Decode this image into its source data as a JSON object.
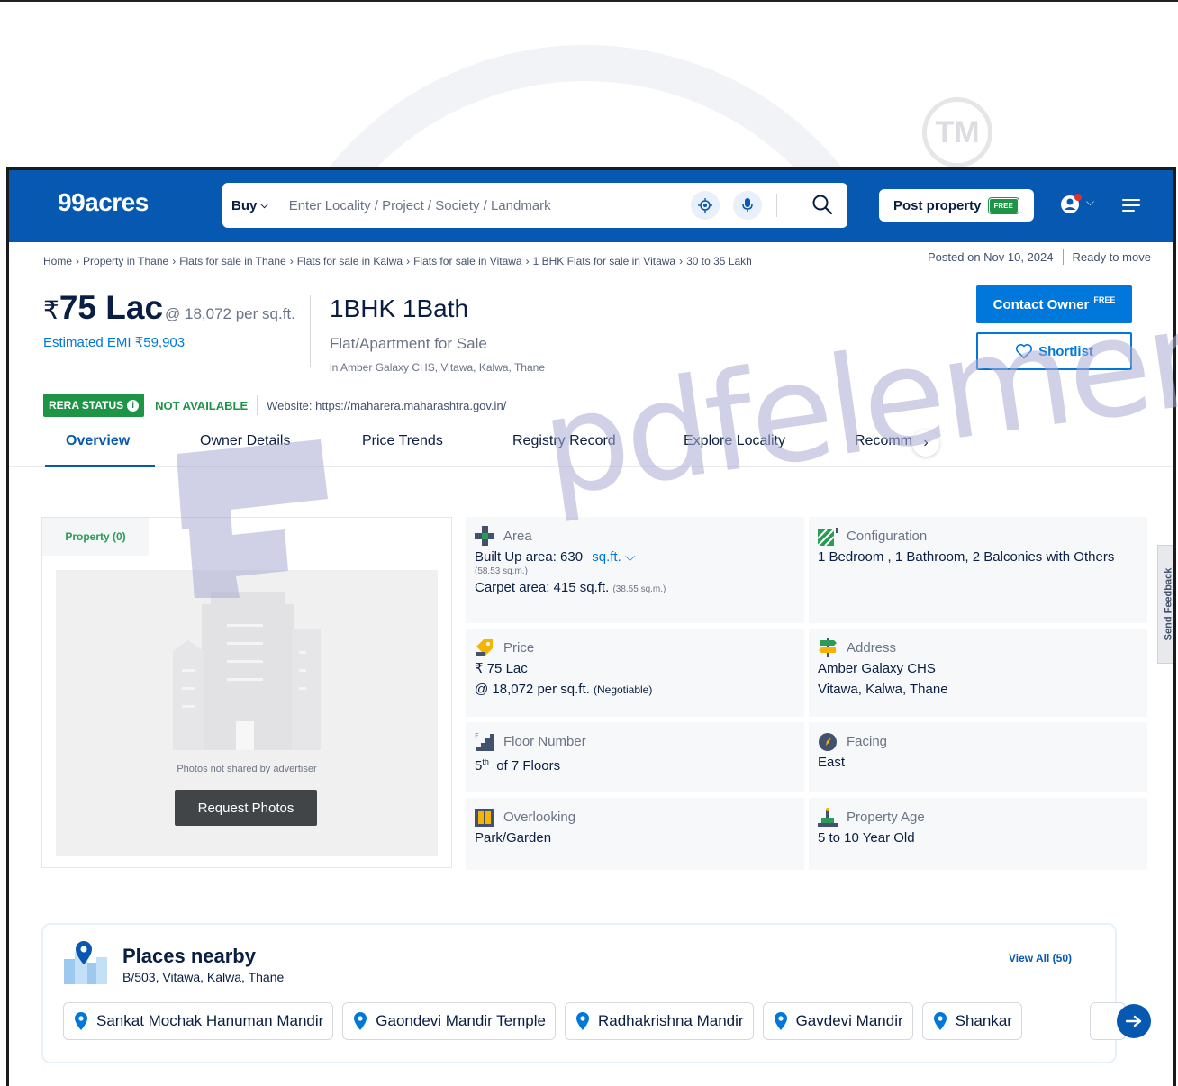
{
  "brand": {
    "logo": "99acres"
  },
  "search": {
    "mode": "Buy",
    "placeholder": "Enter Locality / Project / Society / Landmark"
  },
  "header": {
    "post_property": "Post property",
    "free_tag": "FREE"
  },
  "breadcrumb": [
    "Home",
    "Property in Thane",
    "Flats for sale in Thane",
    "Flats for sale in Kalwa",
    "Flats for sale in Vitawa",
    "1 BHK Flats for sale in Vitawa",
    "30 to 35 Lakh"
  ],
  "posting": {
    "posted_on": "Posted on Nov 10, 2024",
    "status": "Ready to move"
  },
  "listing": {
    "currency": "₹",
    "price": "75 Lac",
    "per_sqft": "@ 18,072 per sq.ft.",
    "emi": "Estimated EMI ₹59,903",
    "title": "1BHK 1Bath",
    "type": "Flat/Apartment for Sale",
    "location": "in Amber Galaxy CHS, Vitawa, Kalwa, Thane"
  },
  "actions": {
    "contact_owner": "Contact Owner",
    "contact_free": "FREE",
    "shortlist": "Shortlist"
  },
  "rera": {
    "badge": "RERA STATUS",
    "status": "NOT AVAILABLE",
    "website": "Website: https://maharera.maharashtra.gov.in/"
  },
  "tabs": [
    "Overview",
    "Owner Details",
    "Price Trends",
    "Registry Record",
    "Explore Locality",
    "Recomm"
  ],
  "photos": {
    "tab": "Property (0)",
    "note": "Photos not shared by advertiser",
    "request": "Request Photos"
  },
  "details": {
    "area": {
      "label": "Area",
      "built_up": "Built Up area: 630",
      "unit": "sq.ft.",
      "built_up_sqm": "(58.53 sq.m.)",
      "carpet": "Carpet area: 415 sq.ft.",
      "carpet_sqm": "(38.55 sq.m.)"
    },
    "configuration": {
      "label": "Configuration",
      "value": "1 Bedroom , 1 Bathroom, 2 Balconies with Others"
    },
    "price": {
      "label": "Price",
      "value": "₹ 75 Lac",
      "per_sqft": "@ 18,072 per sq.ft.",
      "negotiable": "(Negotiable)"
    },
    "address": {
      "label": "Address",
      "line1": "Amber Galaxy CHS",
      "line2": "Vitawa, Kalwa, Thane"
    },
    "floor": {
      "label": "Floor Number",
      "floor": "5",
      "suffix": "th",
      "of_floors": "of 7 Floors"
    },
    "facing": {
      "label": "Facing",
      "value": "East"
    },
    "overlooking": {
      "label": "Overlooking",
      "value": "Park/Garden"
    },
    "age": {
      "label": "Property Age",
      "value": "5 to 10 Year Old"
    }
  },
  "places": {
    "title": "Places nearby",
    "address": "B/503, Vitawa, Kalwa, Thane",
    "view_all": "View All (50)",
    "items": [
      "Sankat Mochak Hanuman Mandir",
      "Gaondevi Mandir Temple",
      "Radhakrishna Mandir",
      "Gavdevi Mandir",
      "Shankar"
    ]
  },
  "feedback": "Send Feedback",
  "watermark": {
    "text": "pdfelement",
    "tm": "TM"
  },
  "colors": {
    "header_blue": "#0758b1",
    "link_blue": "#0078db",
    "rera_green": "#1e9446"
  }
}
